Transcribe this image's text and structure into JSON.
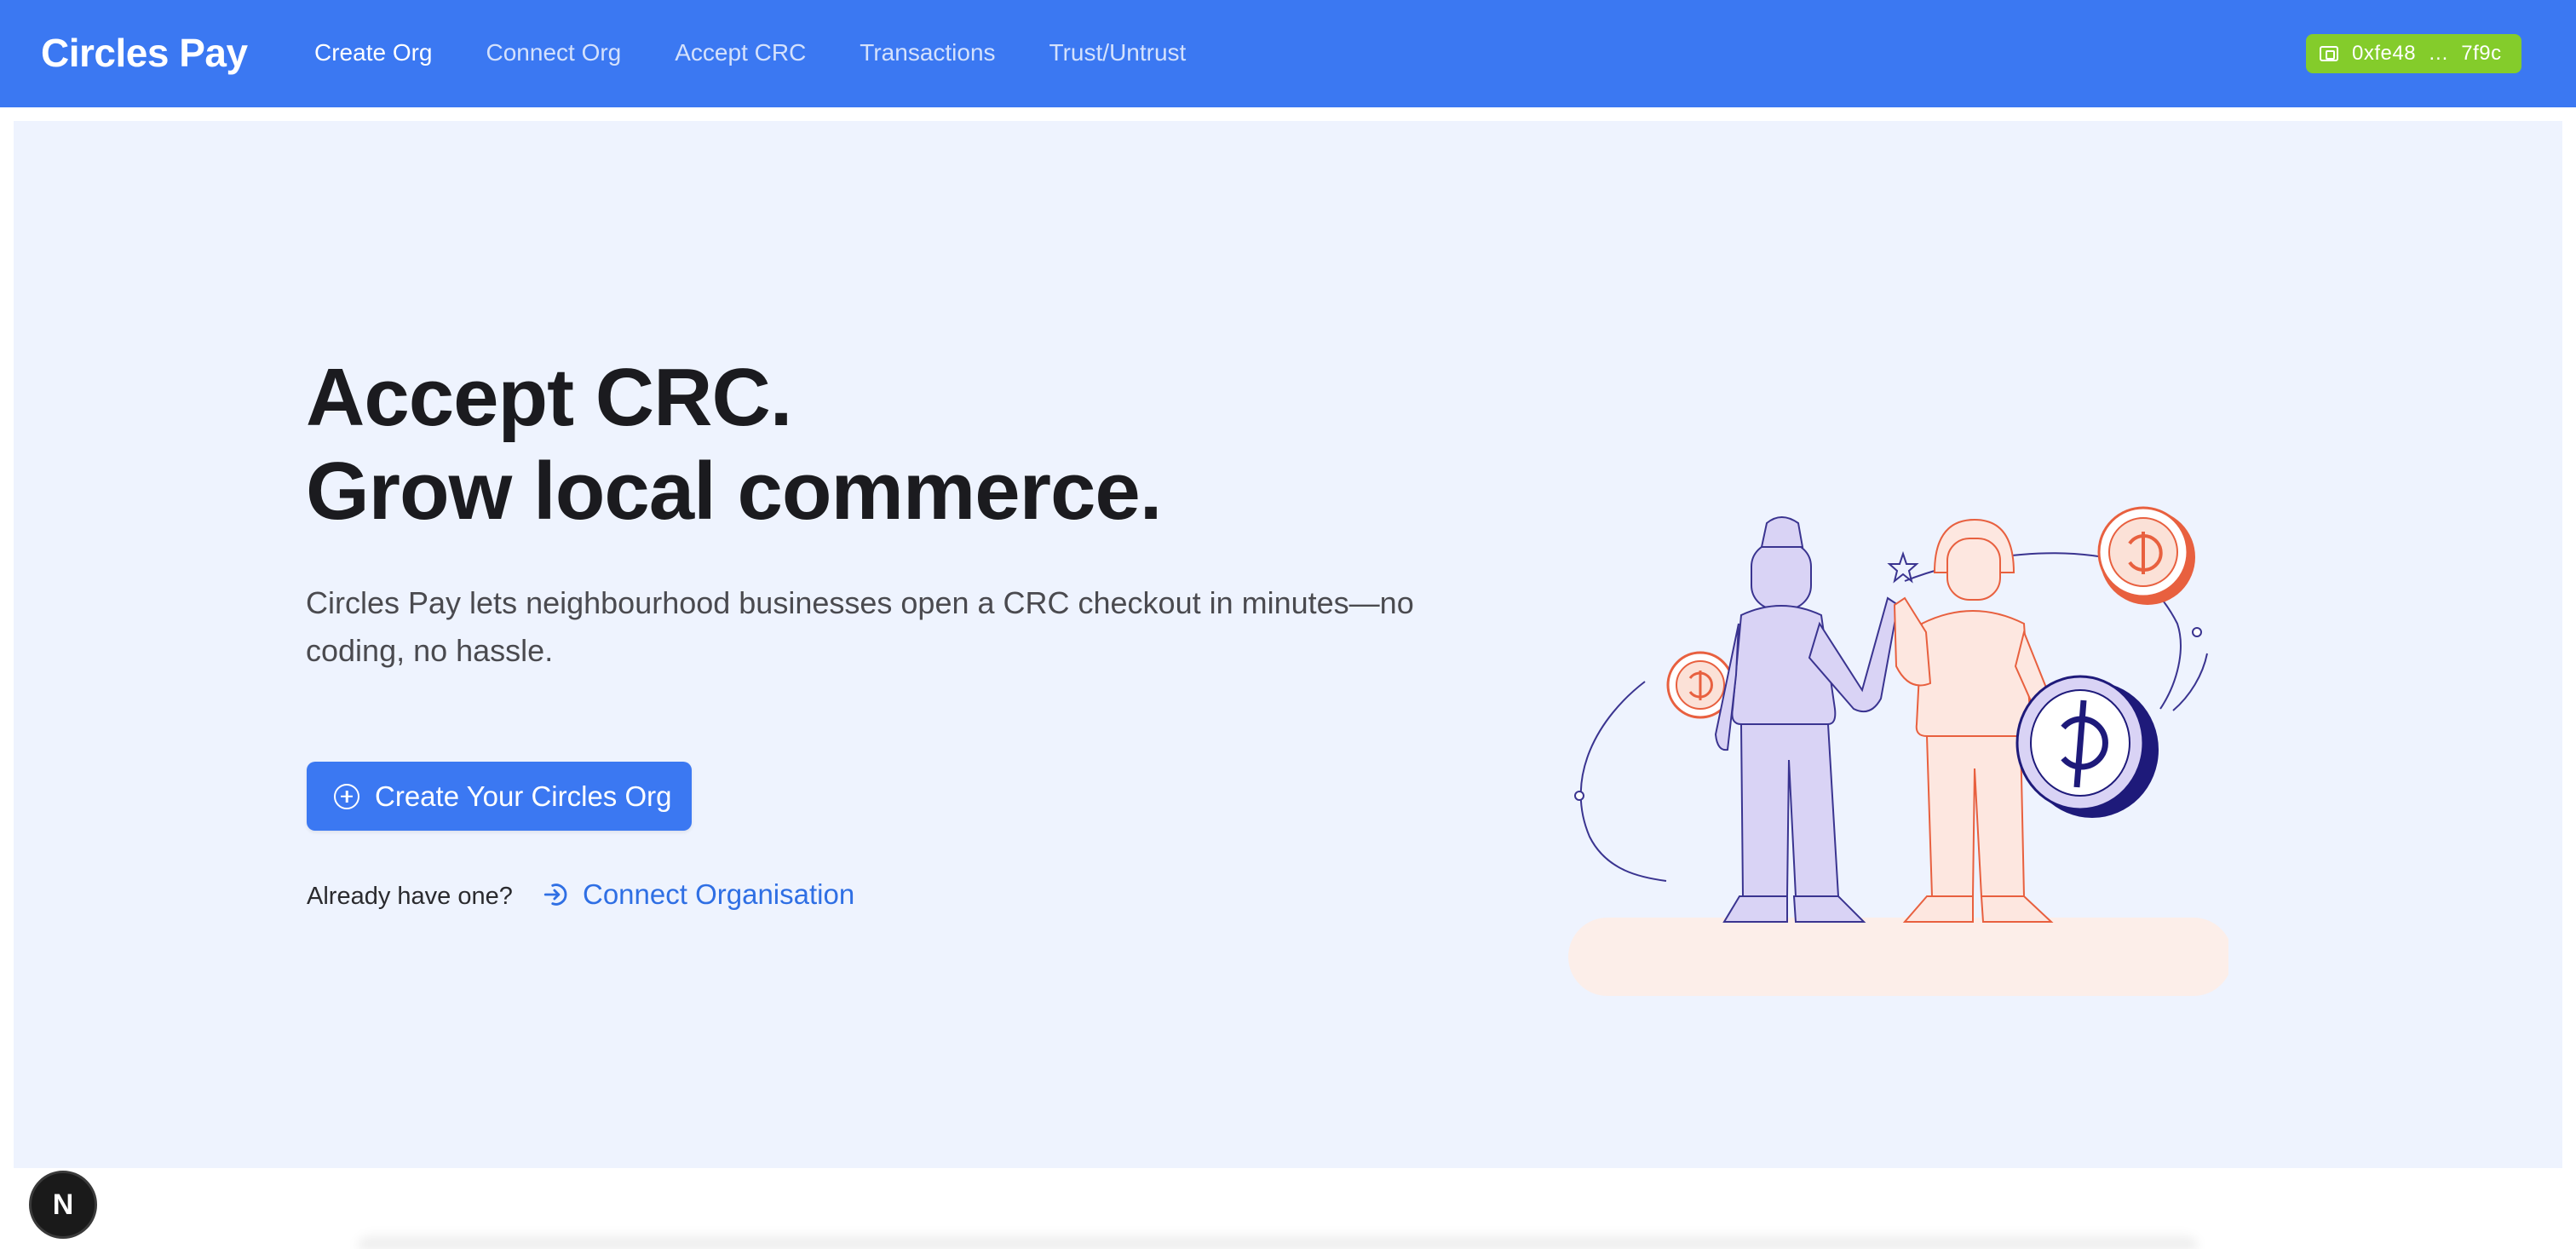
{
  "brand": "Circles Pay",
  "nav": {
    "items": [
      {
        "label": "Create Org",
        "active": true
      },
      {
        "label": "Connect Org",
        "active": false
      },
      {
        "label": "Accept CRC",
        "active": false
      },
      {
        "label": "Transactions",
        "active": false
      },
      {
        "label": "Trust/Untrust",
        "active": false
      }
    ]
  },
  "wallet": {
    "address": "0xfe48  …  7f9c",
    "icon": "wallet-icon",
    "color": "#84cc2b"
  },
  "hero": {
    "headline_line1": "Accept CRC.",
    "headline_line2": "Grow local commerce.",
    "subtext": "Circles Pay lets neighbourhood businesses open a CRC checkout in minutes—no coding, no hassle.",
    "cta_label": "Create Your Circles Org",
    "cta_icon": "plus-circle-icon",
    "already_text": "Already have one?",
    "connect_label": "Connect Organisation",
    "connect_icon": "login-icon"
  },
  "dev_badge": "N",
  "colors": {
    "primary": "#3b78f2",
    "hero_bg": "#eef3fe",
    "link": "#2f6fe4",
    "illustration_violet": "#2e2a8f",
    "illustration_coral": "#ea6a4a"
  }
}
